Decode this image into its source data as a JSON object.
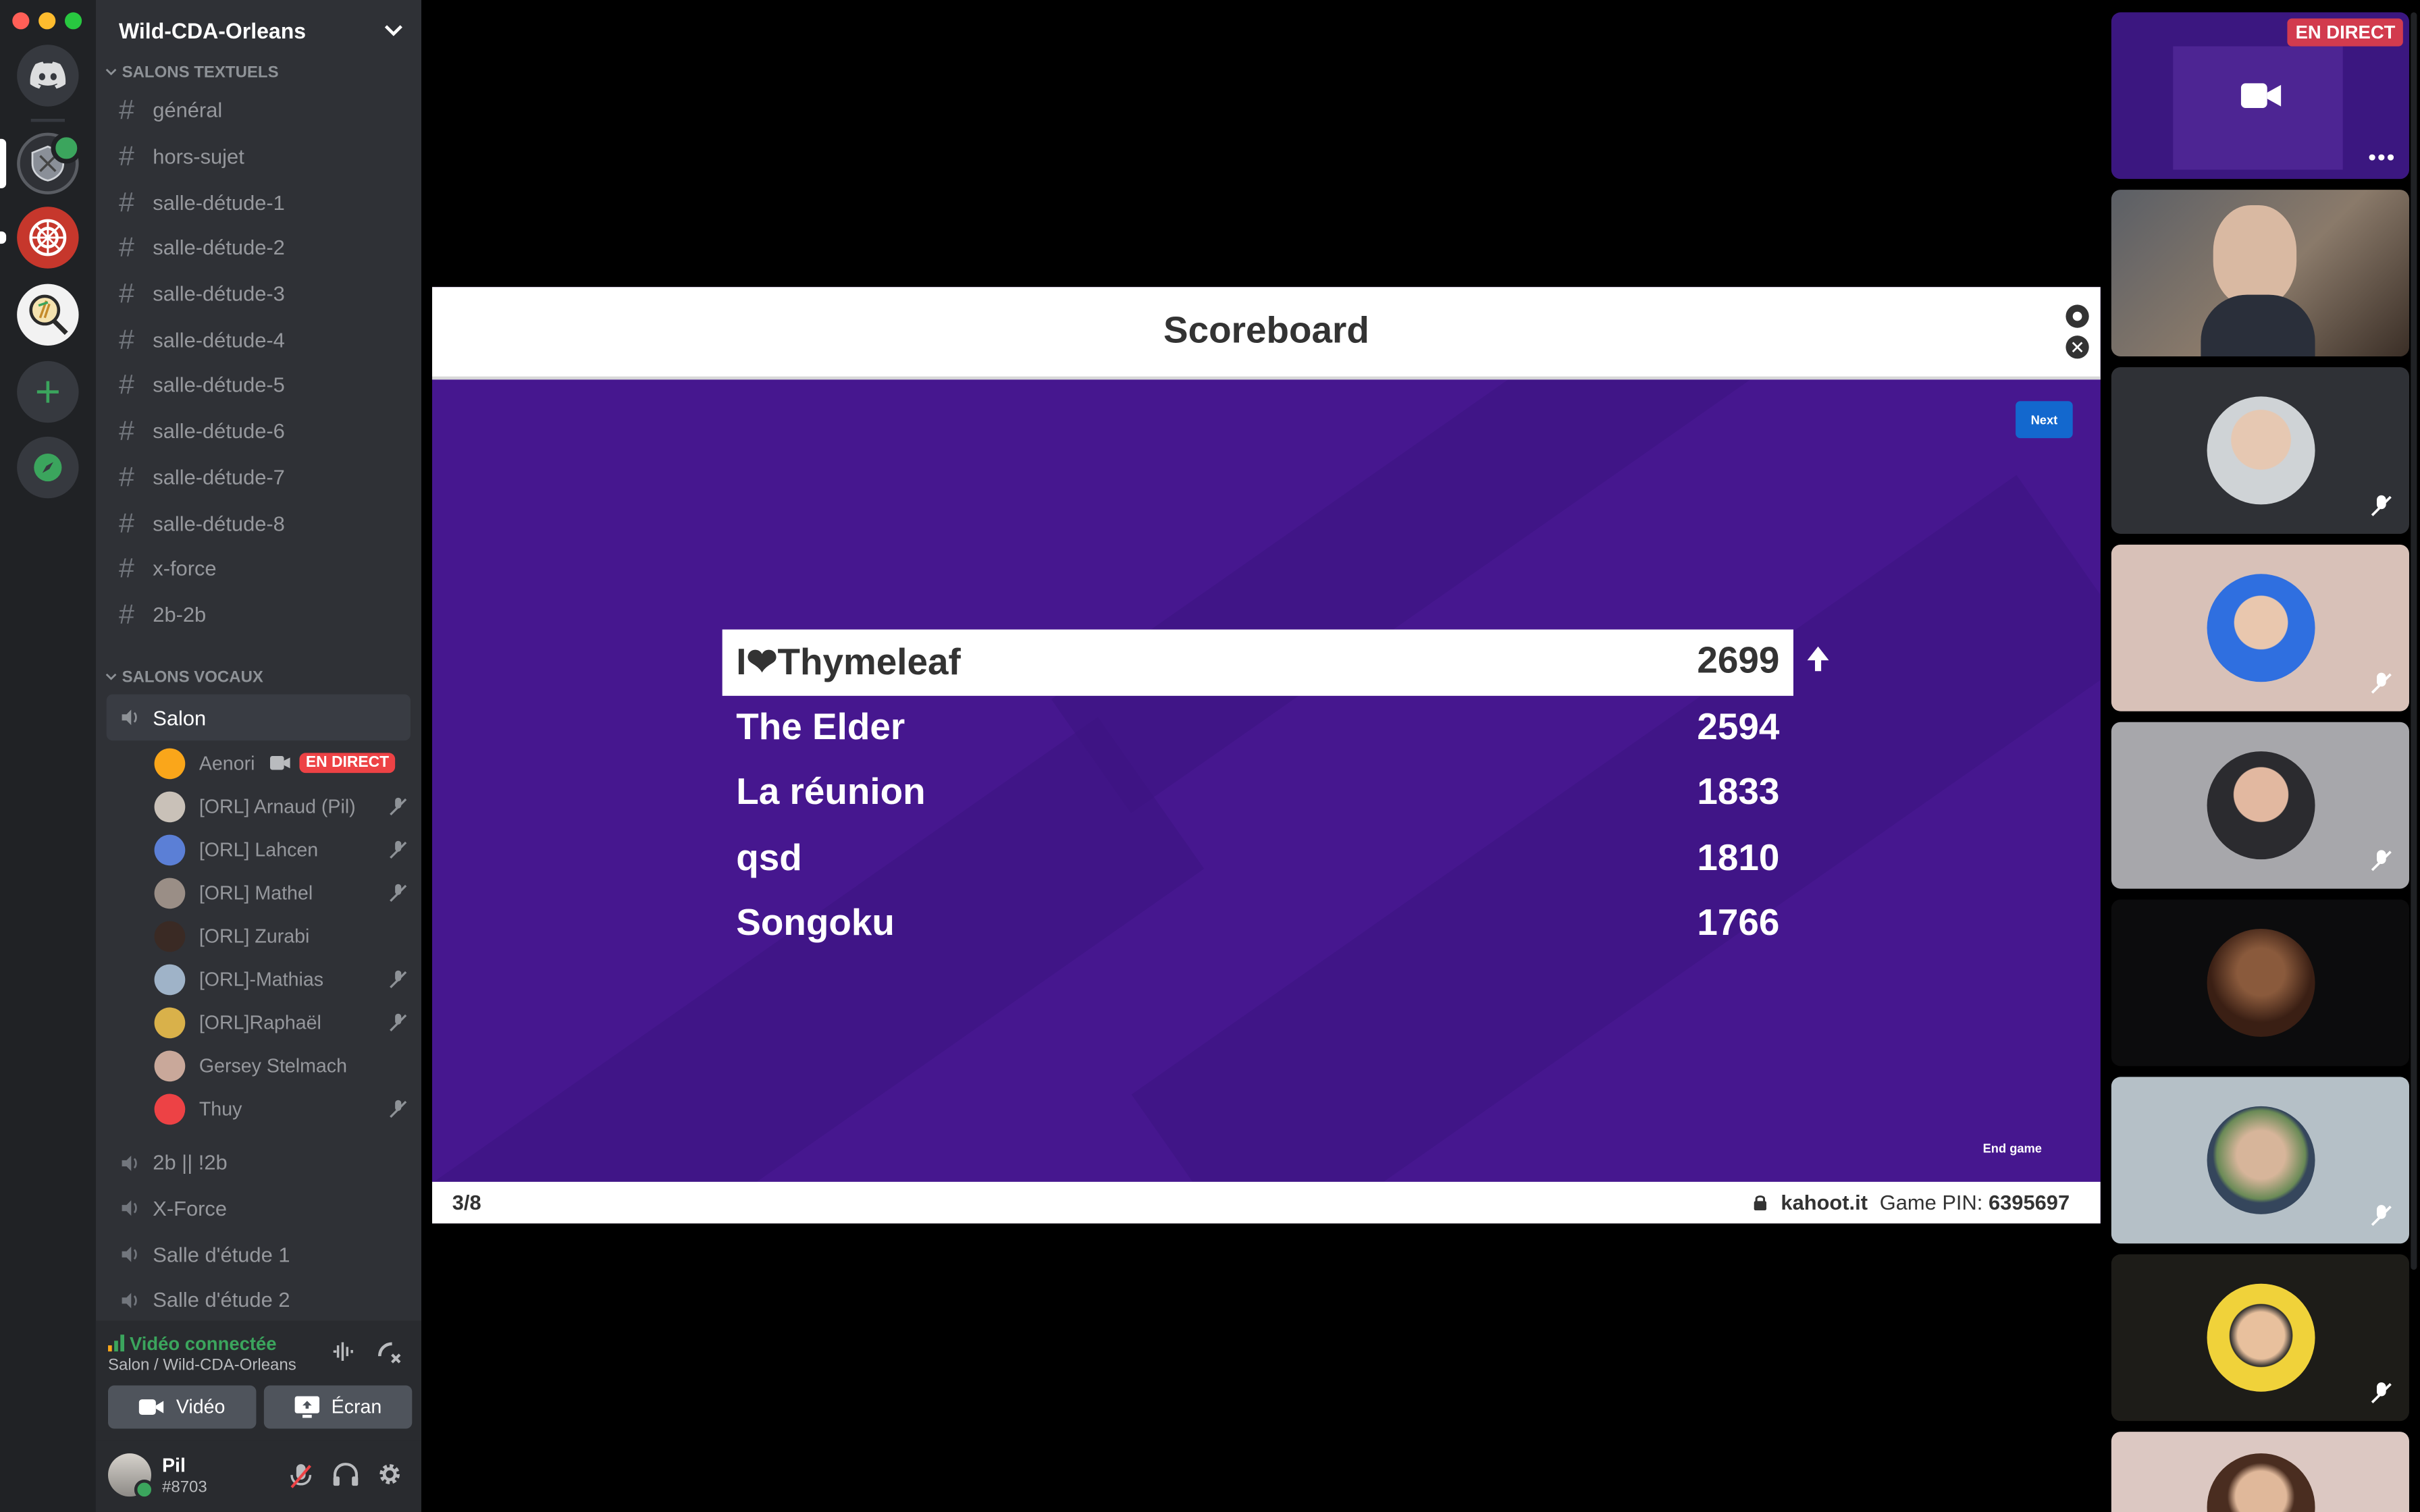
{
  "server": {
    "name": "Wild-CDA-Orleans"
  },
  "text_category": "SALONS TEXTUELS",
  "text_channels": [
    "général",
    "hors-sujet",
    "salle-détude-1",
    "salle-détude-2",
    "salle-détude-3",
    "salle-détude-4",
    "salle-détude-5",
    "salle-détude-6",
    "salle-détude-7",
    "salle-détude-8",
    "x-force",
    "2b-2b"
  ],
  "voice_category": "SALONS VOCAUX",
  "voice_active": "Salon",
  "voice_users": [
    {
      "name": "Aenori",
      "live": "EN DIRECT"
    },
    {
      "name": "[ORL] Arnaud (Pil)"
    },
    {
      "name": "[ORL] Lahcen"
    },
    {
      "name": "[ORL] Mathel"
    },
    {
      "name": "[ORL] Zurabi"
    },
    {
      "name": "[ORL]-Mathias"
    },
    {
      "name": "[ORL]Raphaël"
    },
    {
      "name": "Gersey Stelmach"
    },
    {
      "name": "Thuy"
    }
  ],
  "voice_channels": [
    "2b || !2b",
    "X-Force",
    "Salle d'étude 1",
    "Salle d'étude 2"
  ],
  "voice_panel": {
    "status": "Vidéo connectée",
    "location": "Salon / Wild-CDA-Orleans",
    "video_label": "Vidéo",
    "screen_label": "Écran"
  },
  "user_panel": {
    "name": "Pil",
    "tag": "#8703"
  },
  "stage": {
    "title": "Scoreboard",
    "next": "Next",
    "end_game": "End game",
    "counter": "3/8",
    "site": "kahoot.it",
    "pin_label": "Game PIN:",
    "pin": "6395697",
    "scores": [
      {
        "name": "I❤Thymeleaf",
        "score": "2699"
      },
      {
        "name": "The Elder",
        "score": "2594"
      },
      {
        "name": "La réunion",
        "score": "1833"
      },
      {
        "name": "qsd",
        "score": "1810"
      },
      {
        "name": "Songoku",
        "score": "1766"
      }
    ]
  },
  "tiles": {
    "live_badge": "EN DIRECT"
  },
  "colors": {
    "kahoot_purple": "#46178f",
    "live_red": "#ed4245",
    "green": "#3ba55d",
    "blurple": "#5865f2"
  }
}
